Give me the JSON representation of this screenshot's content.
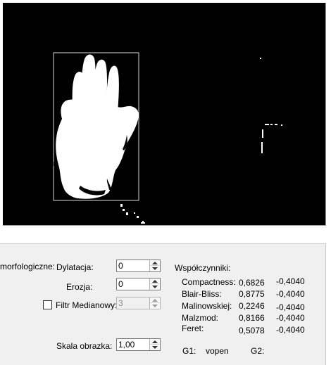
{
  "morphology": {
    "label": "morfologiczne:",
    "dilation": {
      "label": "Dylatacja:",
      "value": "0"
    },
    "erosion": {
      "label": "Erozja:",
      "value": "0"
    },
    "median_filter": {
      "label": "Filtr Medianowy:",
      "checked": false,
      "value": "3"
    }
  },
  "scale": {
    "label": "Skala obrazka:",
    "value": "1,00"
  },
  "coefficients": {
    "title": "Współczynniki:",
    "rows": [
      {
        "name": "Compactness:",
        "value": "0,6826",
        "g": "-0,4040"
      },
      {
        "name": "Blair-Bliss:",
        "value": "0,8775",
        "g": "-0,4040"
      },
      {
        "name": "Malinowskiej:",
        "value": "0,2246",
        "g": "-0,4040"
      },
      {
        "name": "Malzmod:",
        "value": "0,8166",
        "g": "-0,4040"
      },
      {
        "name": "Feret:",
        "value": "0,5078",
        "g": "-0,4040"
      }
    ]
  },
  "gestures": {
    "g1_label": "G1:",
    "g1_value": "vopen",
    "g2_label": "G2:",
    "g2_value": ""
  },
  "colors": {
    "viewport_bg": "#000000",
    "mask": "#ffffff",
    "panel_bg": "#f0f0f0"
  }
}
